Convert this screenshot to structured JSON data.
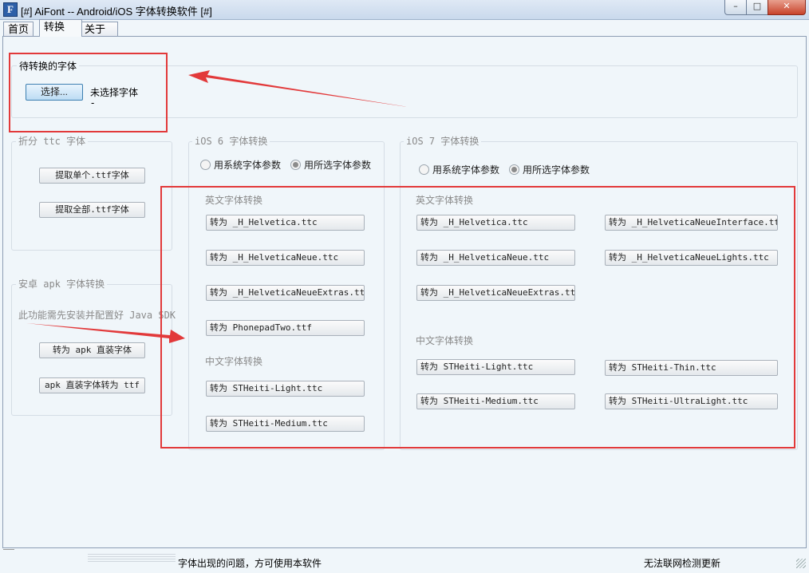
{
  "window": {
    "icon": "F",
    "title": "[#] AiFont -- Android/iOS 字体转换软件 [#]",
    "min_label": "–",
    "max_label": "□",
    "close_label": "✕"
  },
  "tabs": [
    {
      "label": "首页"
    },
    {
      "label": "转换"
    },
    {
      "label": "关于"
    }
  ],
  "pending": {
    "title": "待转换的字体",
    "select_label": "选择...",
    "status": "未选择字体",
    "status_suffix": "-"
  },
  "ttc_split": {
    "title": "折分 ttc 字体",
    "buttons": [
      "提取单个.ttf字体",
      "提取全部.ttf字体"
    ]
  },
  "apk": {
    "title": "安卓 apk 字体转换",
    "note": "此功能需先安装并配置好 Java SDK",
    "buttons": [
      "转为 apk 直装字体",
      "apk 直装字体转为 ttf"
    ]
  },
  "ios6": {
    "title": "iOS 6 字体转换",
    "radios": [
      {
        "label": "用系统字体参数",
        "selected": false
      },
      {
        "label": "用所选字体参数",
        "selected": true
      }
    ],
    "en_label": "英文字体转换",
    "en_buttons": [
      "转为 _H_Helvetica.ttc",
      "转为 _H_HelveticaNeue.ttc",
      "转为 _H_HelveticaNeueExtras.ttc",
      "转为 PhonepadTwo.ttf"
    ],
    "cn_label": "中文字体转换",
    "cn_buttons": [
      "转为 STHeiti-Light.ttc",
      "转为 STHeiti-Medium.ttc"
    ]
  },
  "ios7": {
    "title": "iOS 7 字体转换",
    "radios": [
      {
        "label": "用系统字体参数",
        "selected": false
      },
      {
        "label": "用所选字体参数",
        "selected": true
      }
    ],
    "en_label": "英文字体转换",
    "en_left": [
      "转为 _H_Helvetica.ttc",
      "转为 _H_HelveticaNeue.ttc",
      "转为 _H_HelveticaNeueExtras.ttc"
    ],
    "en_right": [
      "转为 _H_HelveticaNeueInterface.ttc",
      "转为 _H_HelveticaNeueLights.ttc"
    ],
    "cn_label": "中文字体转换",
    "cn_left": [
      "转为 STHeiti-Light.ttc",
      "转为 STHeiti-Medium.ttc"
    ],
    "cn_right": [
      "转为 STHeiti-Thin.ttc",
      "转为 STHeiti-UltraLight.ttc"
    ]
  },
  "status": {
    "message": "字体出现的问题，方可使用本软件",
    "update": "无法联网检测更新"
  },
  "colors": {
    "annotation_red": "#e2393a",
    "window_bg": "#f0f6fa"
  }
}
